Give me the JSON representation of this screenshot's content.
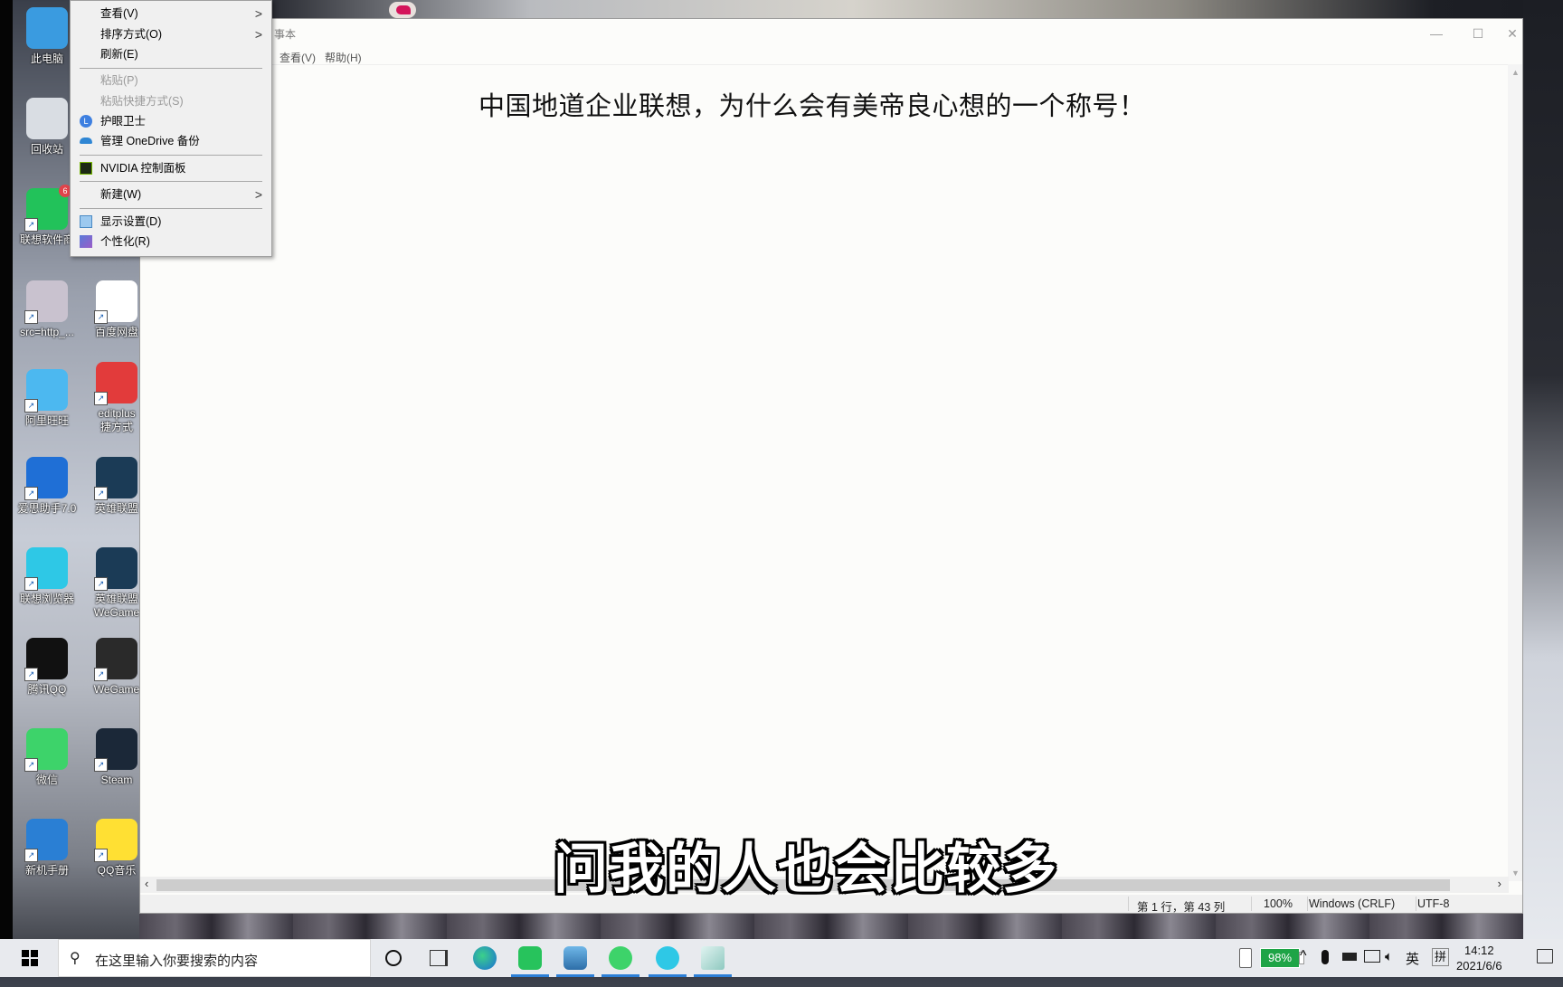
{
  "desktop": {
    "icons": [
      {
        "label": "此电脑",
        "color": "#3a9be0"
      },
      {
        "label": "回收站",
        "color": "#d9dde3"
      },
      {
        "label": "联想软件商",
        "color": "#22c25a",
        "badge": "6"
      },
      {
        "label": "src=http_...",
        "color": "#c9c2cf"
      },
      {
        "label": "百度网盘",
        "color": "#ffffff"
      },
      {
        "label": "阿里旺旺",
        "color": "#4cb8f0"
      },
      {
        "label": "editplus",
        "sublabel": "捷方式",
        "color": "#e23b3b"
      },
      {
        "label": "爱思助手7.0",
        "color": "#1f6fd6"
      },
      {
        "label": "英雄联盟",
        "color": "#1b3b56"
      },
      {
        "label": "联想浏览器",
        "color": "#2ec8e6"
      },
      {
        "label": "英雄联盟",
        "sublabel": "WeGame",
        "color": "#1b3b56"
      },
      {
        "label": "腾讯QQ",
        "color": "#111111"
      },
      {
        "label": "WeGame",
        "color": "#2a2a2a"
      },
      {
        "label": "微信",
        "color": "#3dd36a"
      },
      {
        "label": "Steam",
        "color": "#1b2838"
      },
      {
        "label": "新机手册",
        "color": "#2a7fd4"
      },
      {
        "label": "QQ音乐",
        "color": "#ffe033"
      }
    ]
  },
  "context_menu": {
    "items": [
      {
        "label": "查看(V)",
        "submenu": true,
        "enabled": true
      },
      {
        "label": "排序方式(O)",
        "submenu": true,
        "enabled": true
      },
      {
        "label": "刷新(E)",
        "enabled": true
      },
      {
        "label": "粘贴(P)",
        "enabled": false
      },
      {
        "label": "粘贴快捷方式(S)",
        "enabled": false
      },
      {
        "label": "护眼卫士",
        "enabled": true,
        "icon": "eye-guard-icon"
      },
      {
        "label": "管理 OneDrive 备份",
        "enabled": true,
        "icon": "onedrive-icon"
      },
      {
        "label": "NVIDIA 控制面板",
        "enabled": true,
        "icon": "nvidia-icon"
      },
      {
        "label": "新建(W)",
        "submenu": true,
        "enabled": true
      },
      {
        "label": "显示设置(D)",
        "enabled": true,
        "icon": "display-icon"
      },
      {
        "label": "个性化(R)",
        "enabled": true,
        "icon": "personalize-icon"
      }
    ]
  },
  "notepad": {
    "title_fragment": "事本",
    "menu": [
      "查看(V)",
      "帮助(H)"
    ],
    "content": "中国地道企业联想，为什么会有美帝良心想的一个称号！",
    "status": {
      "position": "第 1 行，第 43 列",
      "zoom": "100%",
      "line_ending": "Windows (CRLF)",
      "encoding": "UTF-8"
    },
    "controls": {
      "minimize": "—",
      "maximize": "☐",
      "close": "✕"
    }
  },
  "subtitle": "问我的人也会比较多",
  "taskbar": {
    "search_placeholder": "在这里输入你要搜索的内容",
    "battery": "98%",
    "ime_lang": "英",
    "ime_mode": "拼",
    "time": "14:12",
    "date": "2021/6/6"
  }
}
